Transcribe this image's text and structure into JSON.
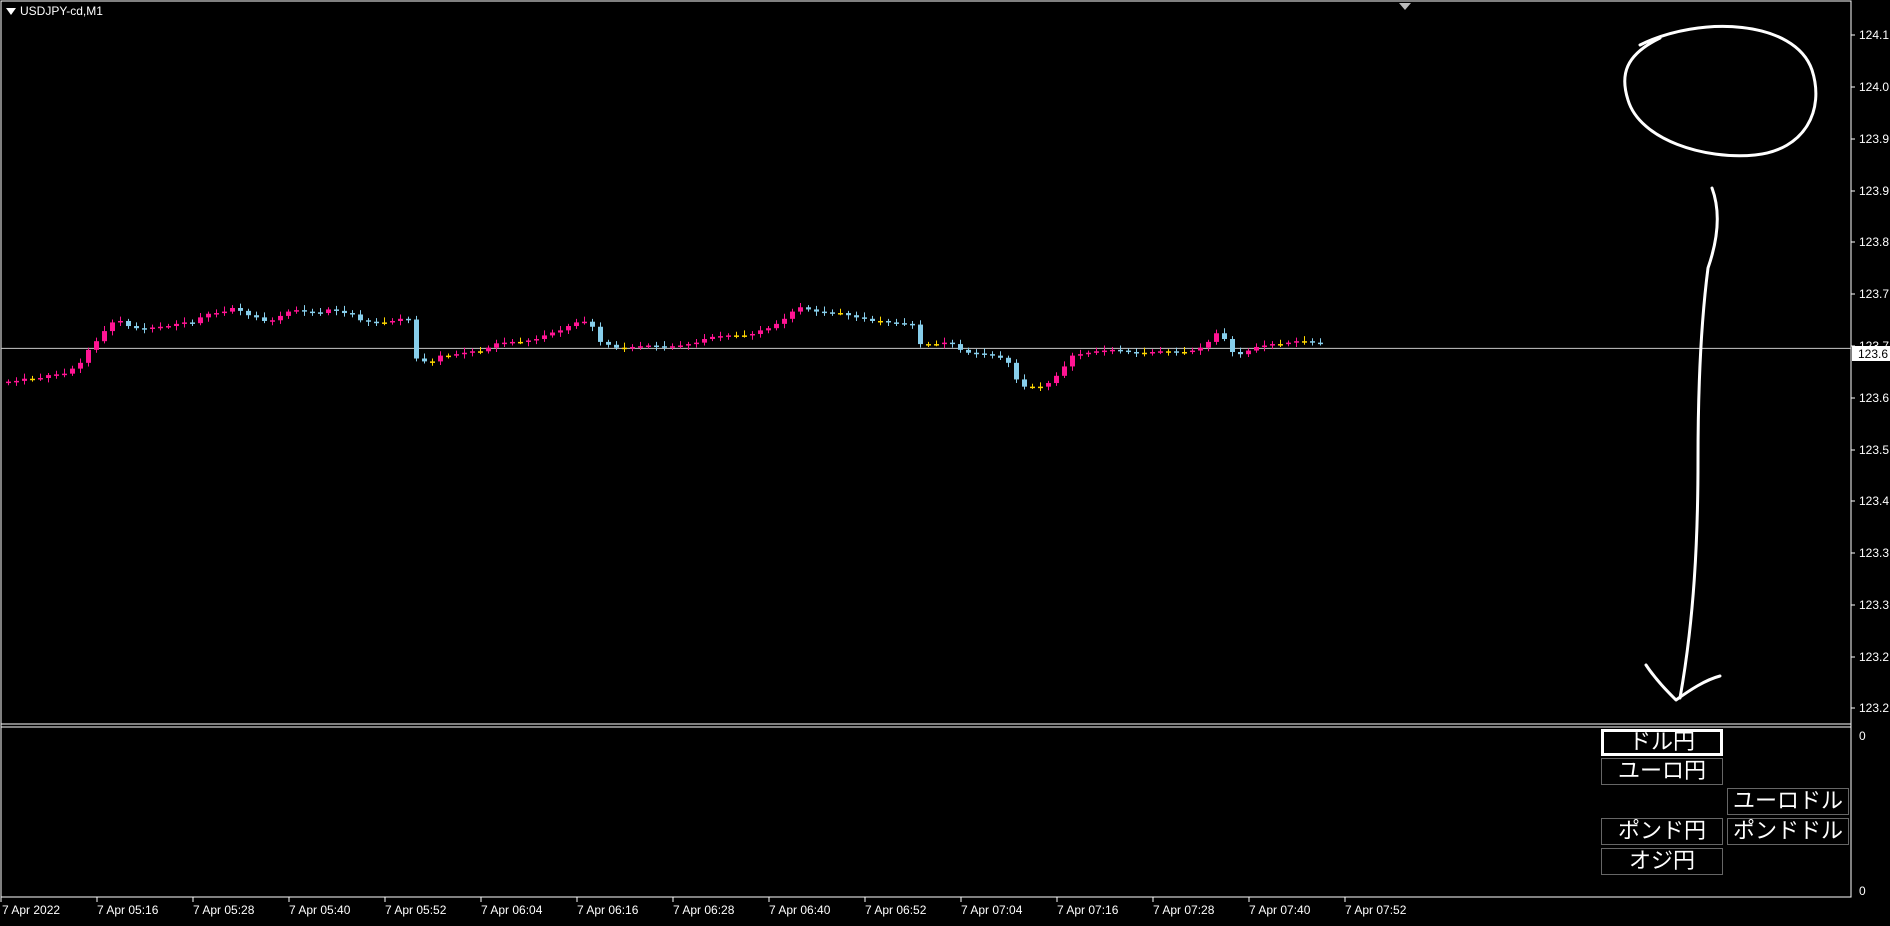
{
  "window": {
    "title": "USDJPY-cd,M1"
  },
  "colors": {
    "background": "#000000",
    "bull": "#ff1493",
    "bear": "#87ceeb",
    "doji": "#ffd700",
    "axis": "#ffffff"
  },
  "price_axis": {
    "labels": [
      "124.1",
      "124.0",
      "123.9",
      "123.9",
      "123.8",
      "123.7",
      "123.7",
      "123.6",
      "123.5",
      "123.4",
      "123.3",
      "123.3",
      "123.2",
      "123.2"
    ],
    "current_price_label": "123.6"
  },
  "sub_window": {
    "scale_top": "0",
    "scale_bottom": "0"
  },
  "time_axis": {
    "labels": [
      "7 Apr 2022",
      "7 Apr 05:16",
      "7 Apr 05:28",
      "7 Apr 05:40",
      "7 Apr 05:52",
      "7 Apr 06:04",
      "7 Apr 06:16",
      "7 Apr 06:28",
      "7 Apr 06:40",
      "7 Apr 06:52",
      "7 Apr 07:04",
      "7 Apr 07:16",
      "7 Apr 07:28",
      "7 Apr 07:40",
      "7 Apr 07:52"
    ]
  },
  "buttons": {
    "usdjpy": "ドル円",
    "eurjpy": "ユーロ円",
    "eurusd": "ユーロドル",
    "gbpjpy": "ポンド円",
    "gbpusd": "ポンドドル",
    "audjpy": "オジ円"
  },
  "chart_data": {
    "type": "candlestick",
    "symbol": "USDJPY-cd",
    "timeframe": "M1",
    "ylim": [
      123.15,
      124.12
    ],
    "current_price": 123.658,
    "close_series": [
      123.612,
      123.613,
      123.616,
      123.616,
      123.617,
      123.621,
      123.622,
      123.623,
      123.63,
      123.638,
      123.656,
      123.668,
      123.682,
      123.694,
      123.696,
      123.689,
      123.686,
      123.685,
      123.687,
      123.688,
      123.689,
      123.692,
      123.694,
      123.693,
      123.701,
      123.706,
      123.707,
      123.709,
      123.714,
      123.71,
      123.704,
      123.701,
      123.696,
      123.697,
      123.703,
      123.709,
      123.711,
      123.709,
      123.708,
      123.707,
      123.712,
      123.71,
      123.707,
      123.705,
      123.697,
      123.695,
      123.694,
      123.694,
      123.696,
      123.699,
      123.698,
      123.644,
      123.64,
      123.64,
      123.648,
      123.648,
      123.65,
      123.652,
      123.654,
      123.654,
      123.659,
      123.665,
      123.666,
      123.667,
      123.667,
      123.669,
      123.671,
      123.676,
      123.68,
      123.683,
      123.689,
      123.694,
      123.695,
      123.688,
      123.667,
      123.663,
      123.659,
      123.659,
      123.66,
      123.661,
      123.662,
      123.661,
      123.66,
      123.661,
      123.662,
      123.664,
      123.666,
      123.671,
      123.674,
      123.675,
      123.676,
      123.676,
      123.676,
      123.678,
      123.683,
      123.686,
      123.692,
      123.699,
      123.709,
      123.715,
      123.712,
      123.709,
      123.708,
      123.707,
      123.707,
      123.704,
      123.701,
      123.699,
      123.696,
      123.696,
      123.694,
      123.693,
      123.692,
      123.691,
      123.664,
      123.664,
      123.664,
      123.666,
      123.664,
      123.656,
      123.652,
      123.651,
      123.65,
      123.648,
      123.645,
      123.638,
      123.615,
      123.605,
      123.605,
      123.605,
      123.61,
      123.62,
      123.633,
      123.648,
      123.65,
      123.652,
      123.654,
      123.655,
      123.656,
      123.655,
      123.653,
      123.652,
      123.652,
      123.653,
      123.654,
      123.654,
      123.653,
      123.653,
      123.655,
      123.659,
      123.667,
      123.679,
      123.671,
      123.653,
      123.65,
      123.655,
      123.66,
      123.662,
      123.664,
      123.664,
      123.666,
      123.668,
      123.668,
      123.666,
      123.665
    ]
  }
}
